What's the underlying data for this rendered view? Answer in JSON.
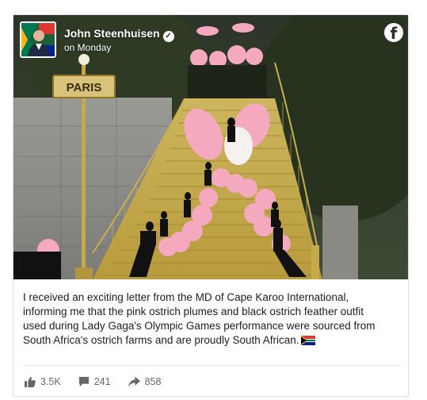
{
  "post": {
    "author": "John Steenhuisen",
    "timestamp": "on Monday",
    "verified_icon": "checkmark-icon",
    "platform_icon": "facebook-icon",
    "photo_sign": "PARIS",
    "text_lines": [
      "I received an exciting letter from the MD of Cape Karoo International,",
      "informing me that the pink ostrich plumes and black ostrich feather outfit",
      "used during Lady Gaga's Olympic Games performance were sourced from",
      "South Africa's ostrich farms and are proudly South African."
    ],
    "text_emoji": "south-africa-flag"
  },
  "stats": {
    "likes": "3.5K",
    "comments": "241",
    "shares": "858"
  },
  "colors": {
    "text": "#1c1e21",
    "muted": "#65676b",
    "border": "#dadde1",
    "feather_pink": "#f4a9bf"
  }
}
